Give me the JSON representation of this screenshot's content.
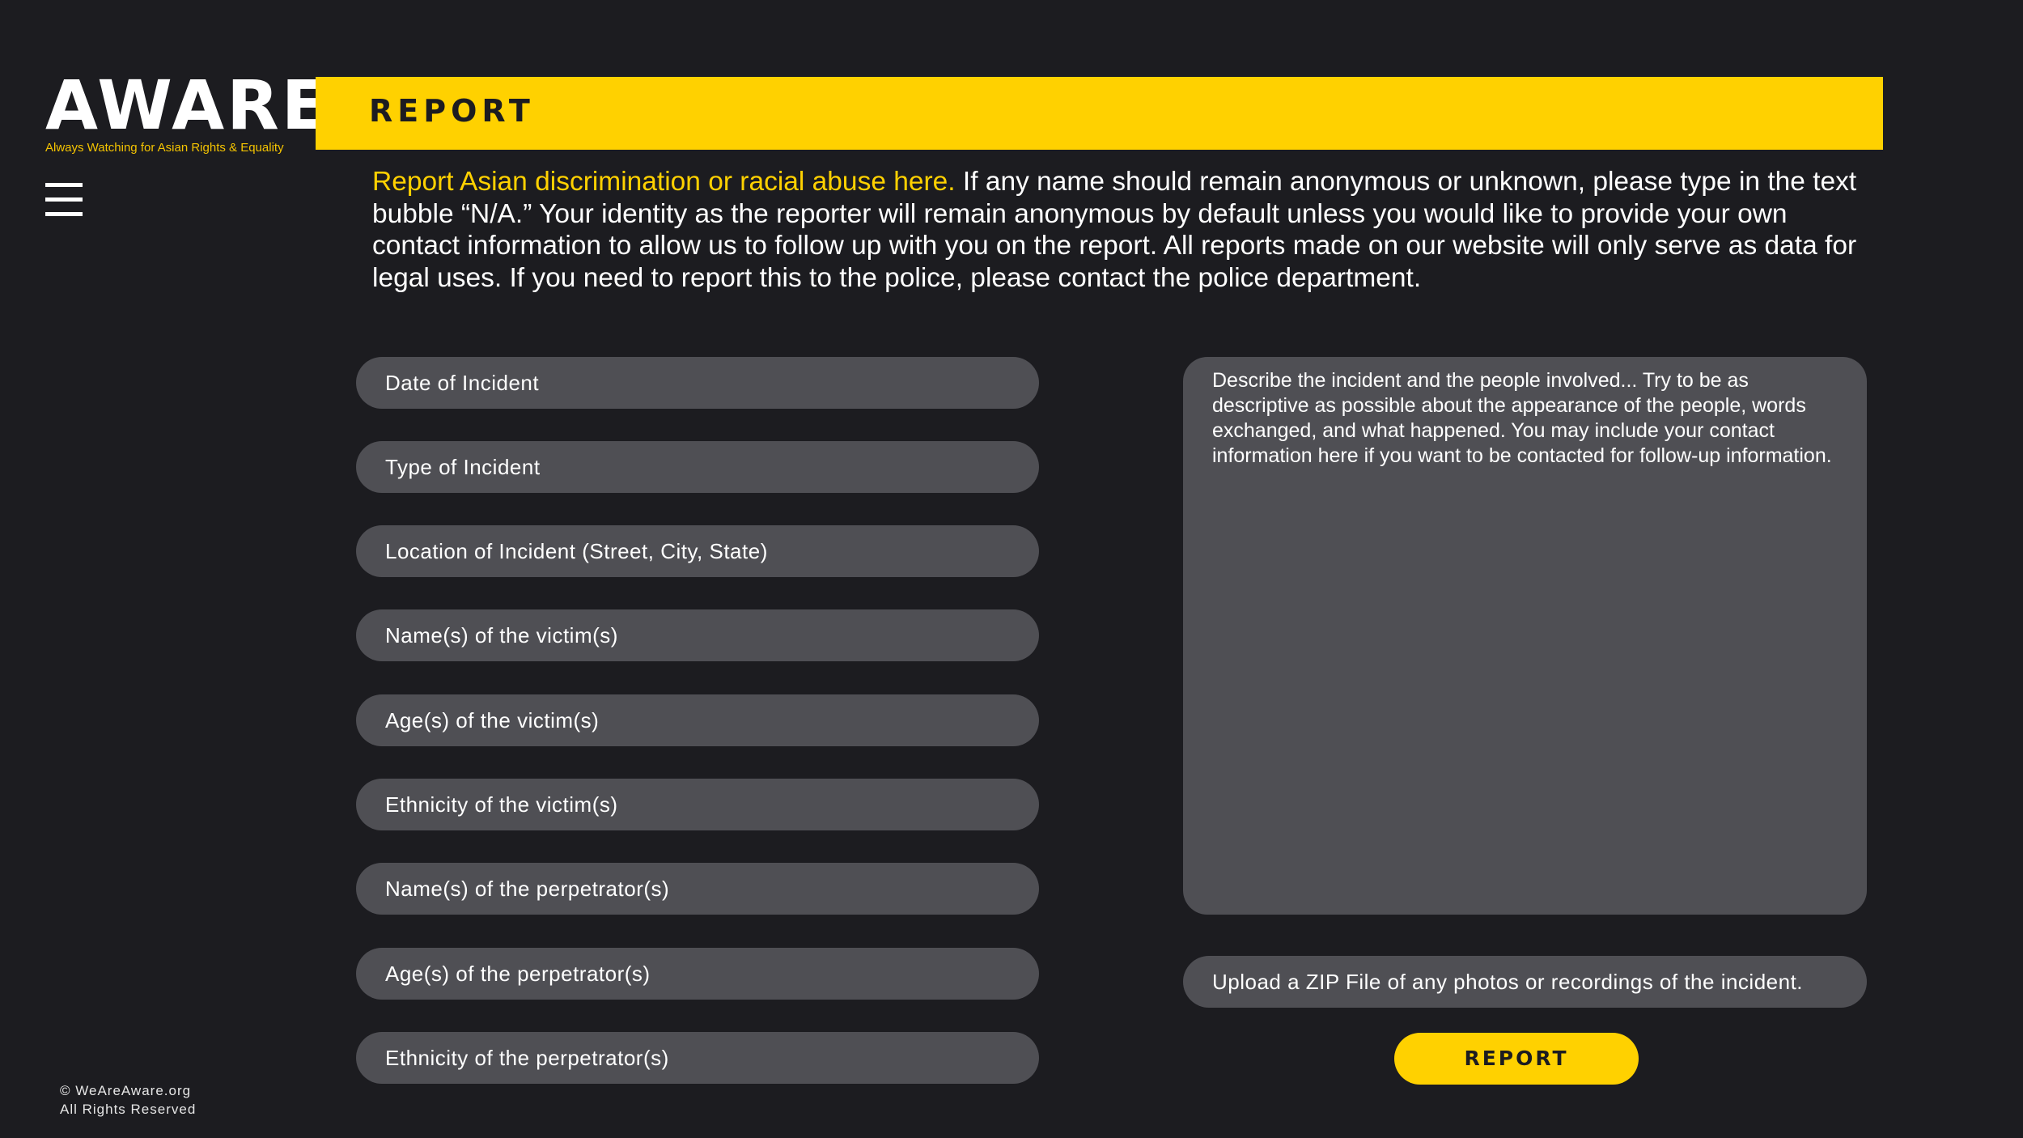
{
  "brand": {
    "name": "AWARE",
    "tagline": "Always Watching for Asian Rights & Equality"
  },
  "colors": {
    "background": "#1c1c20",
    "accent": "#ffd100",
    "field": "#4f4f54"
  },
  "nav": {
    "menu_icon": "hamburger-icon"
  },
  "banner": {
    "title": "REPORT"
  },
  "intro": {
    "highlight": "Report Asian discrimination or racial abuse here.",
    "body": " If any name should remain anonymous or unknown, please type in the text bubble “N/A.” Your identity as the reporter will remain anonymous by default unless you would like to provide your own contact information to allow us to follow up with you on the report. All reports made on our website will only serve as data for legal uses. If you need to report this to the police, please contact the police department."
  },
  "form": {
    "fields": [
      "Date of Incident",
      "Type of Incident",
      "Location of Incident (Street, City, State)",
      "Name(s) of the victim(s)",
      "Age(s) of the victim(s)",
      "Ethnicity of the victim(s)",
      "Name(s) of the perpetrator(s)",
      "Age(s) of the perpetrator(s)",
      "Ethnicity of the perpetrator(s)"
    ],
    "description_placeholder": "Describe the incident and the people involved... Try to be as descriptive as possible about the appearance of the people, words exchanged, and what happened. You may include your contact information here if you want to be contacted for follow-up information.",
    "upload_label": "Upload a ZIP File of any photos or recordings of the incident.",
    "submit_label": "REPORT"
  },
  "footer": {
    "line1": "© WeAreAware.org",
    "line2": "All Rights Reserved"
  }
}
